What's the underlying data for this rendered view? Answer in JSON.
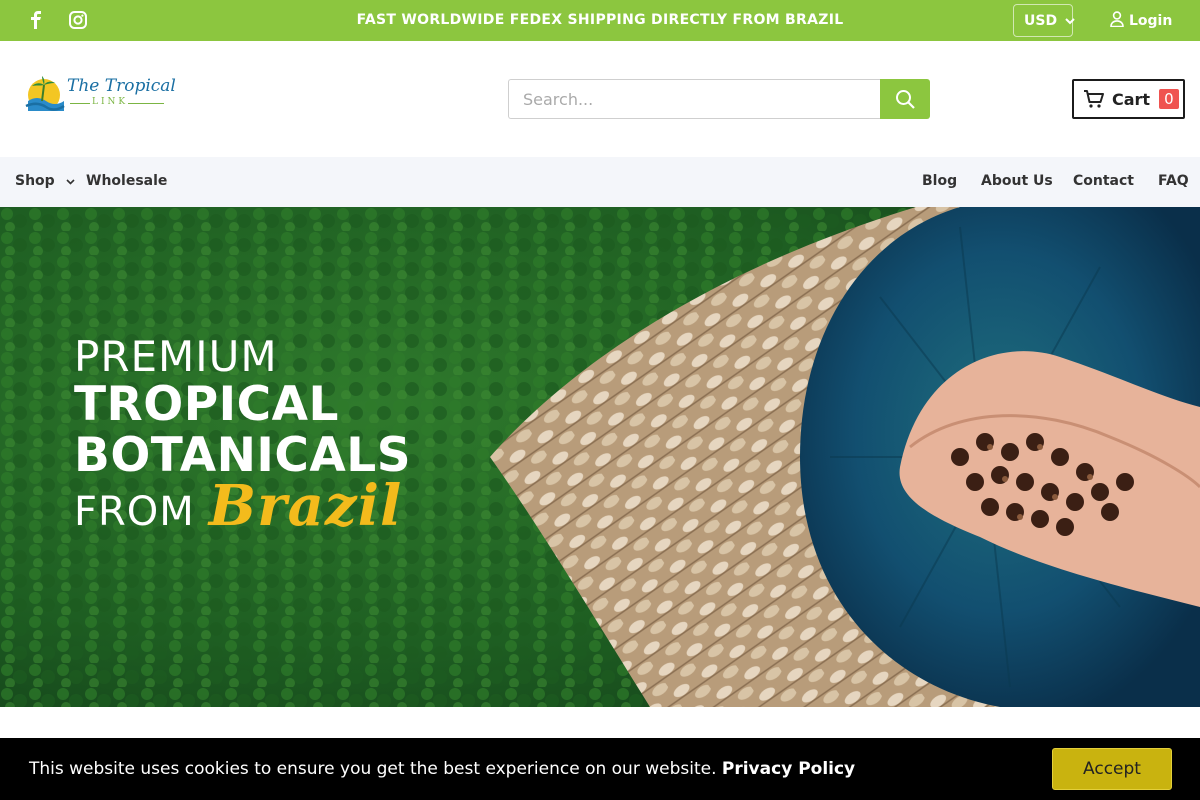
{
  "topbar": {
    "announcement": "FAST WORLDWIDE FEDEX SHIPPING DIRECTLY FROM BRAZIL",
    "currency": "USD",
    "login_label": "Login",
    "bg_color": "#8cc63f"
  },
  "header": {
    "logo_text": "The Tropical",
    "logo_sub": "LINK",
    "search_placeholder": "Search...",
    "cart_label": "Cart",
    "cart_count": "0"
  },
  "nav": {
    "left": [
      {
        "label": "Shop"
      },
      {
        "label": "Wholesale"
      }
    ],
    "right": [
      {
        "label": "Blog"
      },
      {
        "label": "About Us"
      },
      {
        "label": "Contact"
      },
      {
        "label": "FAQ"
      }
    ]
  },
  "hero": {
    "line1": "PREMIUM",
    "line2": "TROPICAL",
    "line3": "BOTANICALS",
    "line4a": "FROM",
    "line4b": "Brazil"
  },
  "cookie": {
    "message": "This website uses cookies to ensure you get the best experience on our website.",
    "link": "Privacy Policy",
    "accept": "Accept"
  },
  "icons": [
    "facebook-icon",
    "instagram-icon",
    "user-icon",
    "search-icon",
    "cart-icon",
    "chevron-down-icon"
  ]
}
